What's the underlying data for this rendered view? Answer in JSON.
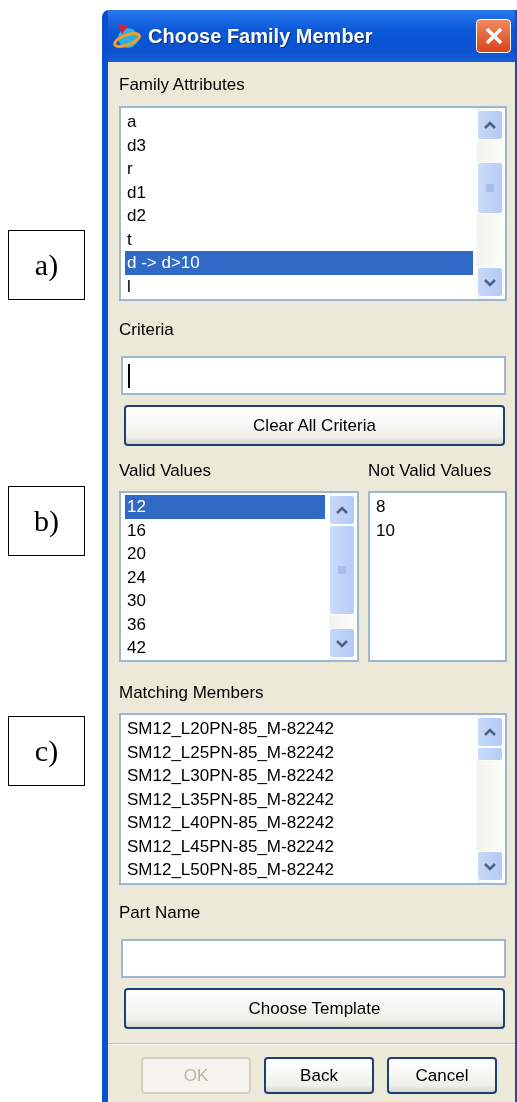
{
  "figure_labels": [
    "a)",
    "b)",
    "c)"
  ],
  "window": {
    "title": "Choose Family Member"
  },
  "family_attributes": {
    "label": "Family Attributes",
    "items": [
      {
        "text": "a",
        "selected": false
      },
      {
        "text": "d3",
        "selected": false
      },
      {
        "text": "r",
        "selected": false
      },
      {
        "text": "d1",
        "selected": false
      },
      {
        "text": "d2",
        "selected": false
      },
      {
        "text": "t",
        "selected": false
      },
      {
        "text": "d -> d>10",
        "selected": true
      },
      {
        "text": "l",
        "selected": false
      }
    ]
  },
  "criteria": {
    "label": "Criteria",
    "focused": true
  },
  "clear_button": "Clear All Criteria",
  "valid_values": {
    "label": "Valid Values",
    "items": [
      {
        "text": "12",
        "selected": true
      },
      {
        "text": "16",
        "selected": false
      },
      {
        "text": "20",
        "selected": false
      },
      {
        "text": "24",
        "selected": false
      },
      {
        "text": "30",
        "selected": false
      },
      {
        "text": "36",
        "selected": false
      },
      {
        "text": "42",
        "selected": false
      }
    ]
  },
  "not_valid_values": {
    "label": "Not Valid Values",
    "items": [
      "8",
      "10"
    ]
  },
  "matching_members": {
    "label": "Matching Members",
    "items": [
      "SM12_L20PN-85_M-82242",
      "SM12_L25PN-85_M-82242",
      "SM12_L30PN-85_M-82242",
      "SM12_L35PN-85_M-82242",
      "SM12_L40PN-85_M-82242",
      "SM12_L45PN-85_M-82242",
      "SM12_L50PN-85_M-82242"
    ]
  },
  "part_name": {
    "label": "Part Name",
    "focused": false
  },
  "template_button": "Choose Template",
  "buttons": [
    {
      "label": "OK",
      "disabled": true
    },
    {
      "label": "Back",
      "disabled": false
    },
    {
      "label": "Cancel",
      "disabled": false
    }
  ]
}
